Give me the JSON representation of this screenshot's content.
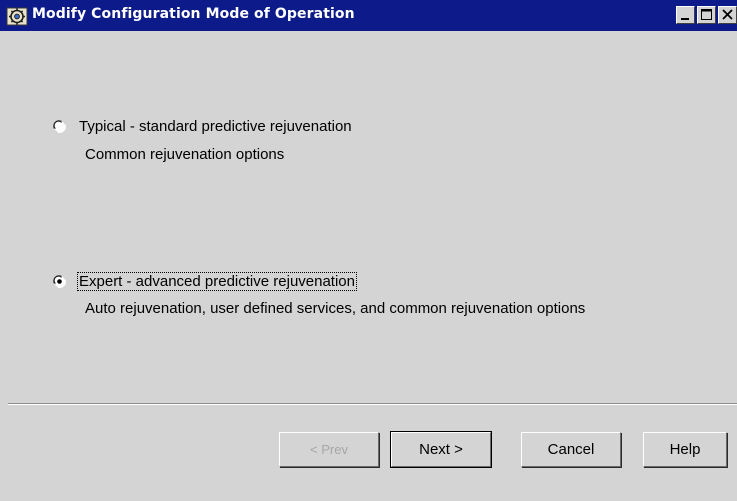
{
  "window": {
    "title": "Modify Configuration Mode of Operation",
    "icon": "app-gear-icon"
  },
  "options": [
    {
      "label": "Typical - standard predictive rejuvenation",
      "description": "Common rejuvenation options",
      "selected": false
    },
    {
      "label": "Expert - advanced predictive rejuvenation",
      "description": "Auto rejuvenation, user defined services, and common rejuvenation options",
      "selected": true
    }
  ],
  "buttons": {
    "prev": "< Prev",
    "next": "Next >",
    "cancel": "Cancel",
    "help": "Help"
  },
  "colors": {
    "titlebar": "#0c1a8a",
    "background": "#d4d4d4",
    "disabled_text": "#a6a6a6"
  }
}
